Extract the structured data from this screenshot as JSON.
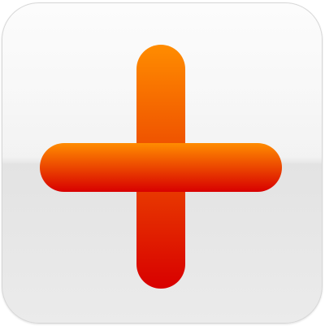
{
  "icon": {
    "name": "plus-icon",
    "colors": {
      "gradient_top": "#ff8c00",
      "gradient_bottom": "#d80000",
      "tile_light": "#f8f8f8",
      "tile_dark": "#e3e3e3",
      "tile_border": "#d6d6d6"
    }
  }
}
